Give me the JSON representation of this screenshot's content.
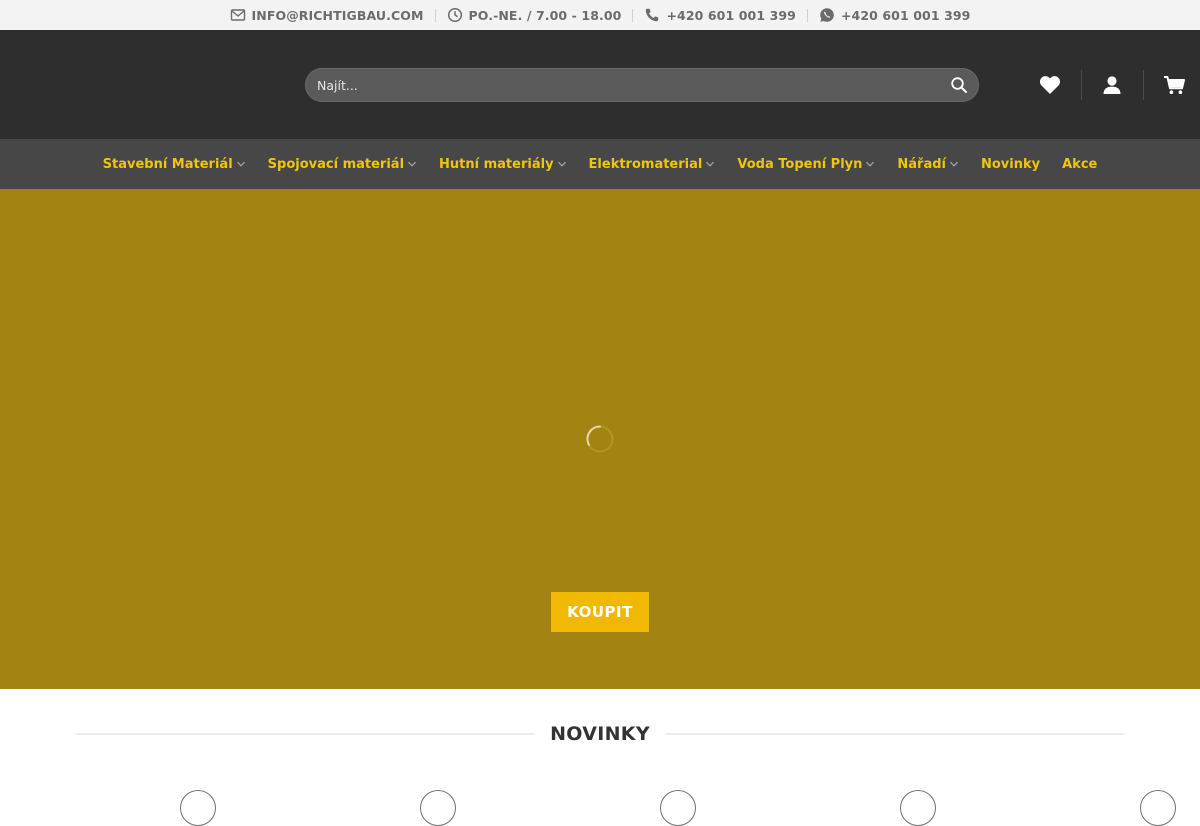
{
  "topbar": {
    "email": "INFO@RICHTIGBAU.COM",
    "hours": "PO.-NE. / 7.00 - 18.00",
    "phone": "+420 601 001 399",
    "whatsapp": "+420 601 001 399"
  },
  "header": {
    "search_placeholder": "Najít...",
    "icons": [
      "heart-icon",
      "user-icon",
      "cart-icon"
    ]
  },
  "nav": {
    "items": [
      {
        "label": "Stavební Materiál",
        "dropdown": true
      },
      {
        "label": "Spojovací materiál",
        "dropdown": true
      },
      {
        "label": "Hutní materiály",
        "dropdown": true
      },
      {
        "label": "Elektromaterial",
        "dropdown": true
      },
      {
        "label": "Voda Topení Plyn",
        "dropdown": true
      },
      {
        "label": "Nářadí",
        "dropdown": true
      },
      {
        "label": "Novinky",
        "dropdown": false
      },
      {
        "label": "Akce",
        "dropdown": false
      }
    ]
  },
  "hero": {
    "button_label": "KOUPIT"
  },
  "section": {
    "title": "NOVINKY"
  },
  "colors": {
    "accent": "#f1c40f",
    "hero_bg": "#a38412",
    "button_bg": "#f0b800",
    "header_bg": "#2e2e2e",
    "nav_bg": "#474747"
  }
}
